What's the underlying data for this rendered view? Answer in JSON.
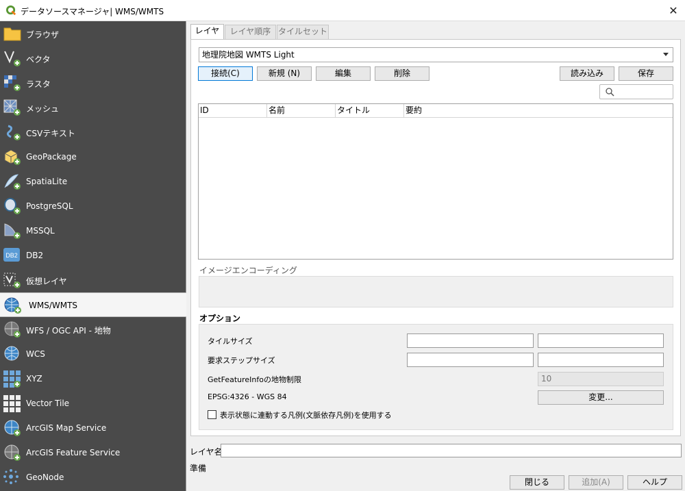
{
  "window": {
    "title": "データソースマネージャ| WMS/WMTS",
    "close_glyph": "✕"
  },
  "sidebar": {
    "items": [
      {
        "label": "ブラウザ",
        "icon": "folder-icon"
      },
      {
        "label": "ベクタ",
        "icon": "vector-icon"
      },
      {
        "label": "ラスタ",
        "icon": "raster-icon"
      },
      {
        "label": "メッシュ",
        "icon": "mesh-icon"
      },
      {
        "label": "CSVテキスト",
        "icon": "csv-icon"
      },
      {
        "label": "GeoPackage",
        "icon": "geopackage-icon"
      },
      {
        "label": "SpatiaLite",
        "icon": "spatialite-icon"
      },
      {
        "label": "PostgreSQL",
        "icon": "postgresql-icon"
      },
      {
        "label": "MSSQL",
        "icon": "mssql-icon"
      },
      {
        "label": "DB2",
        "icon": "db2-icon"
      },
      {
        "label": "仮想レイヤ",
        "icon": "virtual-layer-icon"
      },
      {
        "label": "WMS/WMTS",
        "icon": "wms-icon"
      },
      {
        "label": "WFS / OGC API - 地物",
        "icon": "wfs-icon"
      },
      {
        "label": "WCS",
        "icon": "wcs-icon"
      },
      {
        "label": "XYZ",
        "icon": "xyz-icon"
      },
      {
        "label": "Vector Tile",
        "icon": "vector-tile-icon"
      },
      {
        "label": "ArcGIS Map Service",
        "icon": "arcgis-map-icon"
      },
      {
        "label": "ArcGIS Feature Service",
        "icon": "arcgis-feature-icon"
      },
      {
        "label": "GeoNode",
        "icon": "geonode-icon"
      }
    ],
    "active_index": 11,
    "db2_text": "DB2"
  },
  "tabs": [
    {
      "label": "レイヤ"
    },
    {
      "label": "レイヤ順序"
    },
    {
      "label": "タイルセット"
    }
  ],
  "connection": {
    "selected": "地理院地図 WMTS Light",
    "connect": "接続(C)",
    "new": "新規 (N)",
    "edit": "編集",
    "delete": "削除",
    "load": "読み込み",
    "save": "保存"
  },
  "search": {
    "placeholder": ""
  },
  "table": {
    "columns": [
      "ID",
      "名前",
      "タイトル",
      "要約"
    ],
    "rows": []
  },
  "image_encoding": {
    "label": "イメージエンコーディング"
  },
  "options": {
    "title": "オプション",
    "tile_size_label": "タイルサイズ",
    "tile_w": "",
    "tile_h": "",
    "request_step_label": "要求ステップサイズ",
    "step_w": "",
    "step_h": "",
    "feature_info_label": "GetFeatureInfoの地物制限",
    "feature_info_value": "10",
    "crs_label": "EPSG:4326 - WGS 84",
    "change_button": "変更...",
    "legend_checkbox": "表示状態に連動する凡例(文脈依存凡例)を使用する",
    "legend_checked": false
  },
  "layer_name": {
    "label": "レイヤ名",
    "value": ""
  },
  "status": "準備",
  "footer": {
    "close": "閉じる",
    "add": "追加(A)",
    "help": "ヘルプ"
  },
  "colors": {
    "sidebar_bg": "#4a4a4a",
    "accent": "#0078d7",
    "qgis_green": "#589632"
  }
}
